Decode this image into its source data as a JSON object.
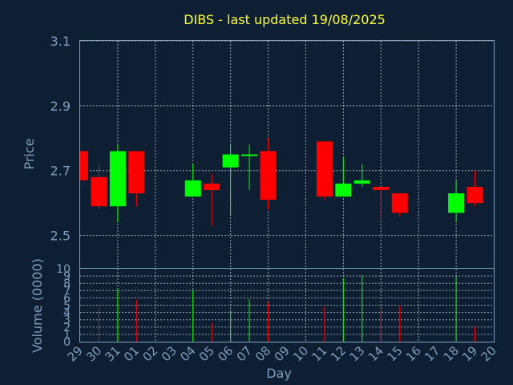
{
  "chart_data": {
    "type": "candlestick",
    "title": "DIBS - last updated 19/08/2025",
    "ylabel": "Price",
    "xlabel": "Day",
    "volume_label": "Volume (0000)",
    "ylim": [
      2.4,
      3.1
    ],
    "yticks": [
      "3.1",
      "2.9",
      "2.7",
      "2.5"
    ],
    "volume_ylim": [
      0,
      10
    ],
    "volume_ticks": [
      "0",
      "1",
      "2",
      "3",
      "4",
      "5",
      "6",
      "7",
      "8",
      "9",
      "10"
    ],
    "x_labels": [
      "29",
      "30",
      "31",
      "01",
      "02",
      "03",
      "04",
      "05",
      "06",
      "07",
      "08",
      "09",
      "10",
      "11",
      "12",
      "13",
      "14",
      "15",
      "16",
      "17",
      "18",
      "19",
      "20"
    ],
    "colors": {
      "up": "#00ff00",
      "down": "#ff0000"
    },
    "candles": [
      {
        "day": 0,
        "open": 2.76,
        "close": 2.67,
        "high": 2.76,
        "low": 2.67
      },
      {
        "day": 1,
        "open": 2.68,
        "close": 2.59,
        "high": 2.72,
        "low": 2.58
      },
      {
        "day": 2,
        "open": 2.59,
        "close": 2.76,
        "high": 2.78,
        "low": 2.54
      },
      {
        "day": 3,
        "open": 2.76,
        "close": 2.63,
        "high": 2.76,
        "low": 2.59
      },
      {
        "day": 6,
        "open": 2.62,
        "close": 2.67,
        "high": 2.72,
        "low": 2.62
      },
      {
        "day": 7,
        "open": 2.66,
        "close": 2.64,
        "high": 2.69,
        "low": 2.53
      },
      {
        "day": 8,
        "open": 2.71,
        "close": 2.75,
        "high": 2.78,
        "low": 2.56
      },
      {
        "day": 9,
        "open": 2.75,
        "close": 2.75,
        "high": 2.78,
        "low": 2.64
      },
      {
        "day": 10,
        "open": 2.76,
        "close": 2.61,
        "high": 2.8,
        "low": 2.58
      },
      {
        "day": 13,
        "open": 2.79,
        "close": 2.62,
        "high": 2.79,
        "low": 2.61
      },
      {
        "day": 14,
        "open": 2.62,
        "close": 2.66,
        "high": 2.74,
        "low": 2.62
      },
      {
        "day": 15,
        "open": 2.66,
        "close": 2.67,
        "high": 2.72,
        "low": 2.65
      },
      {
        "day": 16,
        "open": 2.65,
        "close": 2.64,
        "high": 2.65,
        "low": 2.55
      },
      {
        "day": 17,
        "open": 2.63,
        "close": 2.57,
        "high": 2.63,
        "low": 2.56
      },
      {
        "day": 20,
        "open": 2.57,
        "close": 2.63,
        "high": 2.67,
        "low": 2.54
      },
      {
        "day": 21,
        "open": 2.65,
        "close": 2.6,
        "high": 2.7,
        "low": 2.59
      }
    ],
    "volume": [
      {
        "day": 1,
        "value": 4.8,
        "dir": "down"
      },
      {
        "day": 2,
        "value": 7.2,
        "dir": "up"
      },
      {
        "day": 3,
        "value": 5.7,
        "dir": "down"
      },
      {
        "day": 6,
        "value": 7.0,
        "dir": "up"
      },
      {
        "day": 7,
        "value": 2.6,
        "dir": "down"
      },
      {
        "day": 8,
        "value": 4.3,
        "dir": "up"
      },
      {
        "day": 9,
        "value": 5.8,
        "dir": "up"
      },
      {
        "day": 10,
        "value": 5.4,
        "dir": "down"
      },
      {
        "day": 13,
        "value": 4.8,
        "dir": "down"
      },
      {
        "day": 14,
        "value": 8.7,
        "dir": "up"
      },
      {
        "day": 15,
        "value": 9.1,
        "dir": "up"
      },
      {
        "day": 16,
        "value": 4.4,
        "dir": "down"
      },
      {
        "day": 17,
        "value": 4.9,
        "dir": "down"
      },
      {
        "day": 20,
        "value": 8.9,
        "dir": "up"
      },
      {
        "day": 21,
        "value": 2.0,
        "dir": "down"
      }
    ]
  }
}
